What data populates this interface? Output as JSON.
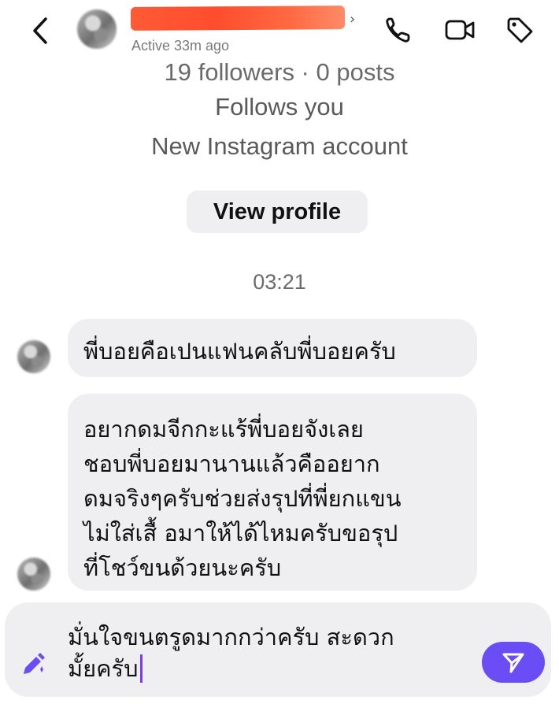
{
  "header": {
    "status": "Active 33m ago",
    "icons": [
      "back-icon",
      "phone-icon",
      "video-icon",
      "tag-icon"
    ]
  },
  "profile": {
    "followers": "19 followers · 0 posts",
    "follows": "Follows you",
    "account_note": "New Instagram account",
    "view_profile": "View profile"
  },
  "thread": {
    "timestamp": "03:21",
    "messages": [
      {
        "lines": [
          "พี่บอยคือเปนแฟนคลับพี่บอยครับ"
        ]
      },
      {
        "lines": [
          "อยากดมจีกกะแร้พี่บอยจังเลย",
          "ชอบพี่บอยมานานแล้วคืออยาก",
          "ดมจริงๆครับช่วยส่งรุปที่พี่ยกแขน",
          "ไม่ใส่เสื้ อมาให้ได้ไหมครับขอรุป",
          "ที่โชว์ขนด้วยนะครับ"
        ]
      }
    ]
  },
  "composer": {
    "lines": [
      "มั่นใจขนตรูดมากกว่าครับ สะดวก",
      "มั้ยครับ"
    ],
    "accent": "#6a4df4"
  }
}
